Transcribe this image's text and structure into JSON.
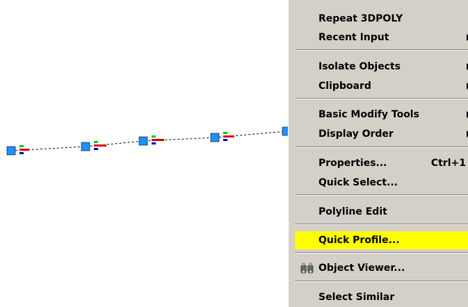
{
  "context_menu": {
    "items": [
      {
        "id": "repeat-3dpoly",
        "label": "Repeat 3DPOLY",
        "shortcut": "",
        "submenu": false,
        "highlighted": false
      },
      {
        "id": "recent-input",
        "label": "Recent Input",
        "shortcut": "",
        "submenu": true,
        "highlighted": false
      },
      {
        "id": "isolate-objects",
        "label": "Isolate Objects",
        "shortcut": "",
        "submenu": true,
        "highlighted": false
      },
      {
        "id": "clipboard",
        "label": "Clipboard",
        "shortcut": "",
        "submenu": true,
        "highlighted": false
      },
      {
        "id": "basic-modify-tools",
        "label": "Basic Modify Tools",
        "shortcut": "",
        "submenu": true,
        "highlighted": false
      },
      {
        "id": "display-order",
        "label": "Display Order",
        "shortcut": "",
        "submenu": true,
        "highlighted": false
      },
      {
        "id": "properties",
        "label": "Properties...",
        "shortcut": "Ctrl+1",
        "submenu": false,
        "highlighted": false
      },
      {
        "id": "quick-select",
        "label": "Quick Select...",
        "shortcut": "",
        "submenu": false,
        "highlighted": false
      },
      {
        "id": "polyline-edit",
        "label": "Polyline Edit",
        "shortcut": "",
        "submenu": false,
        "highlighted": false
      },
      {
        "id": "quick-profile",
        "label": "Quick Profile...",
        "shortcut": "",
        "submenu": false,
        "highlighted": true
      },
      {
        "id": "object-viewer",
        "label": "Object Viewer...",
        "shortcut": "",
        "submenu": false,
        "highlighted": false,
        "icon": "binoculars-icon"
      },
      {
        "id": "select-similar",
        "label": "Select Similar",
        "shortcut": "",
        "submenu": false,
        "highlighted": false
      }
    ]
  },
  "colors": {
    "menu_bg": "#d4d0c8",
    "highlight": "#ffff00",
    "grip": "#1e90ff",
    "polyline": "#000000"
  }
}
